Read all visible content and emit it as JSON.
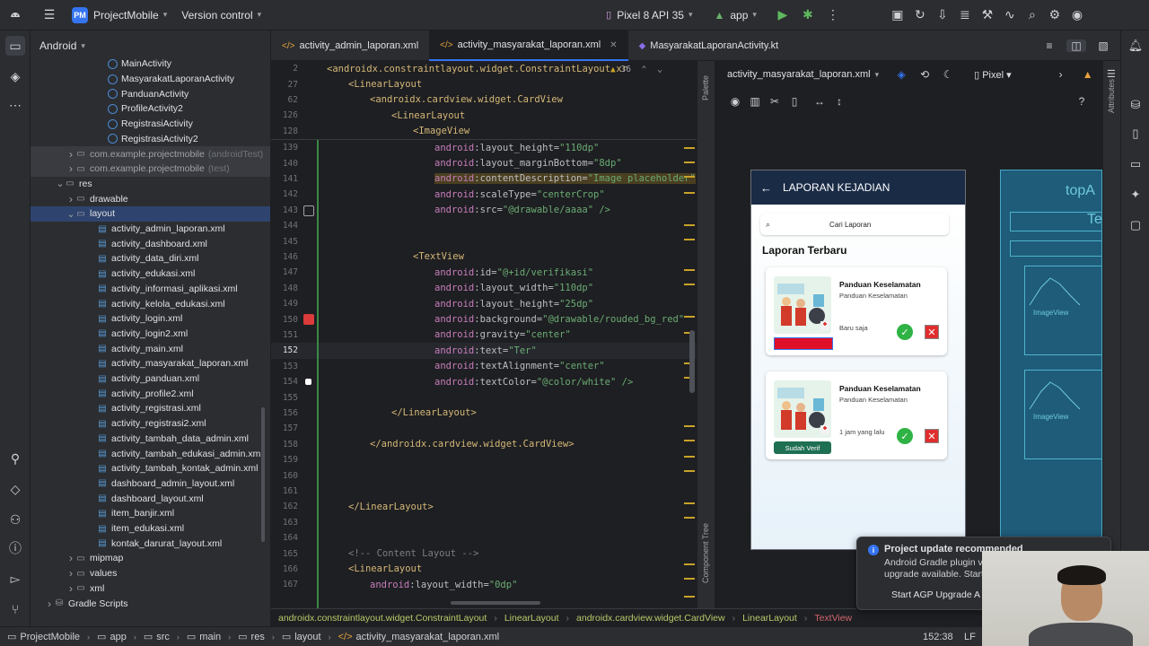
{
  "topbar": {
    "project_badge": "PM",
    "project_name": "ProjectMobile",
    "vcs": "Version control",
    "device": "Pixel 8 API 35",
    "run_config": "app"
  },
  "project_panel": {
    "view": "Android",
    "items": [
      {
        "label": "MainActivity",
        "kind": "class",
        "indent": 6
      },
      {
        "label": "MasyarakatLaporanActivity",
        "kind": "class",
        "indent": 6
      },
      {
        "label": "PanduanActivity",
        "kind": "class",
        "indent": 6
      },
      {
        "label": "ProfileActivity2",
        "kind": "class",
        "indent": 6
      },
      {
        "label": "RegistrasiActivity",
        "kind": "class",
        "indent": 6
      },
      {
        "label": "RegistrasiActivity2",
        "kind": "class",
        "indent": 6
      },
      {
        "label": "com.example.projectmobile",
        "suffix": "(androidTest)",
        "kind": "pkg",
        "indent": 3,
        "hl": true
      },
      {
        "label": "com.example.projectmobile",
        "suffix": "(test)",
        "kind": "pkg",
        "indent": 3,
        "hl": true
      },
      {
        "label": "res",
        "kind": "folder-open",
        "indent": 2
      },
      {
        "label": "drawable",
        "kind": "folder",
        "indent": 3
      },
      {
        "label": "layout",
        "kind": "folder-open",
        "indent": 3,
        "sel": true
      },
      {
        "label": "activity_admin_laporan.xml",
        "kind": "xml",
        "indent": 5
      },
      {
        "label": "activity_dashboard.xml",
        "kind": "xml",
        "indent": 5
      },
      {
        "label": "activity_data_diri.xml",
        "kind": "xml",
        "indent": 5
      },
      {
        "label": "activity_edukasi.xml",
        "kind": "xml",
        "indent": 5
      },
      {
        "label": "activity_informasi_aplikasi.xml",
        "kind": "xml",
        "indent": 5
      },
      {
        "label": "activity_kelola_edukasi.xml",
        "kind": "xml",
        "indent": 5
      },
      {
        "label": "activity_login.xml",
        "kind": "xml",
        "indent": 5
      },
      {
        "label": "activity_login2.xml",
        "kind": "xml",
        "indent": 5
      },
      {
        "label": "activity_main.xml",
        "kind": "xml",
        "indent": 5
      },
      {
        "label": "activity_masyarakat_laporan.xml",
        "kind": "xml",
        "indent": 5
      },
      {
        "label": "activity_panduan.xml",
        "kind": "xml",
        "indent": 5
      },
      {
        "label": "activity_profile2.xml",
        "kind": "xml",
        "indent": 5
      },
      {
        "label": "activity_registrasi.xml",
        "kind": "xml",
        "indent": 5
      },
      {
        "label": "activity_registrasi2.xml",
        "kind": "xml",
        "indent": 5
      },
      {
        "label": "activity_tambah_data_admin.xml",
        "kind": "xml",
        "indent": 5
      },
      {
        "label": "activity_tambah_edukasi_admin.xml",
        "kind": "xml",
        "indent": 5
      },
      {
        "label": "activity_tambah_kontak_admin.xml",
        "kind": "xml",
        "indent": 5
      },
      {
        "label": "dashboard_admin_layout.xml",
        "kind": "xml",
        "indent": 5
      },
      {
        "label": "dashboard_layout.xml",
        "kind": "xml",
        "indent": 5
      },
      {
        "label": "item_banjir.xml",
        "kind": "xml",
        "indent": 5
      },
      {
        "label": "item_edukasi.xml",
        "kind": "xml",
        "indent": 5
      },
      {
        "label": "kontak_darurat_layout.xml",
        "kind": "xml",
        "indent": 5
      },
      {
        "label": "mipmap",
        "kind": "folder",
        "indent": 3
      },
      {
        "label": "values",
        "kind": "folder",
        "indent": 3
      },
      {
        "label": "xml",
        "kind": "folder",
        "indent": 3
      },
      {
        "label": "Gradle Scripts",
        "kind": "gradle",
        "indent": 1
      }
    ]
  },
  "tabs": [
    {
      "label": "activity_admin_laporan.xml",
      "kind": "xml",
      "active": false
    },
    {
      "label": "activity_masyarakat_laporan.xml",
      "kind": "xml",
      "active": true
    },
    {
      "label": "MasyarakatLaporanActivity.kt",
      "kind": "kt",
      "active": false
    }
  ],
  "editor": {
    "inspection_count": "36",
    "sticky": [
      {
        "ln": "2",
        "indent": 0,
        "text": "<androidx.constraintlayout.widget.ConstraintLayout xr"
      },
      {
        "ln": "27",
        "indent": 1,
        "text": "<LinearLayout"
      },
      {
        "ln": "62",
        "indent": 2,
        "text": "<androidx.cardview.widget.CardView"
      },
      {
        "ln": "126",
        "indent": 3,
        "text": "<LinearLayout"
      },
      {
        "ln": "128",
        "indent": 4,
        "text": "<ImageView"
      }
    ],
    "lines": [
      {
        "ln": "139",
        "ns": "android",
        "attr": "layout_height",
        "val": "\"110dp\""
      },
      {
        "ln": "140",
        "ns": "android",
        "attr": "layout_marginBottom",
        "val": "\"8dp\""
      },
      {
        "ln": "141",
        "ns": "android",
        "attr": "contentDescription",
        "val": "\"Image placeholder\"",
        "warn": true
      },
      {
        "ln": "142",
        "ns": "android",
        "attr": "scaleType",
        "val": "\"centerCrop\""
      },
      {
        "ln": "143",
        "ns": "android",
        "attr": "src",
        "val": "\"@drawable/aaaa\" />"
      },
      {
        "ln": "144",
        "raw": ""
      },
      {
        "ln": "145",
        "raw": ""
      },
      {
        "ln": "146",
        "tag": "<TextView",
        "indent": 4
      },
      {
        "ln": "147",
        "ns": "android",
        "attr": "id",
        "val": "\"@+id/verifikasi\""
      },
      {
        "ln": "148",
        "ns": "android",
        "attr": "layout_width",
        "val": "\"110dp\""
      },
      {
        "ln": "149",
        "ns": "android",
        "attr": "layout_height",
        "val": "\"25dp\""
      },
      {
        "ln": "150",
        "ns": "android",
        "attr": "background",
        "val": "\"@drawable/rouded_bg_red\""
      },
      {
        "ln": "151",
        "ns": "android",
        "attr": "gravity",
        "val": "\"center\""
      },
      {
        "ln": "152",
        "ns": "android",
        "attr": "text",
        "val": "\"Ter\"",
        "current": true
      },
      {
        "ln": "153",
        "ns": "android",
        "attr": "textAlignment",
        "val": "\"center\""
      },
      {
        "ln": "154",
        "ns": "android",
        "attr": "textColor",
        "val": "\"@color/white\" />"
      },
      {
        "ln": "155",
        "raw": ""
      },
      {
        "ln": "156",
        "tag": "</LinearLayout>",
        "indent": 3
      },
      {
        "ln": "157",
        "raw": ""
      },
      {
        "ln": "158",
        "tag": "</androidx.cardview.widget.CardView>",
        "indent": 2
      },
      {
        "ln": "159",
        "raw": ""
      },
      {
        "ln": "160",
        "raw": ""
      },
      {
        "ln": "161",
        "raw": ""
      },
      {
        "ln": "162",
        "tag": "</LinearLayout>",
        "indent": 1
      },
      {
        "ln": "163",
        "raw": ""
      },
      {
        "ln": "164",
        "raw": ""
      },
      {
        "ln": "165",
        "comment": "<!-- Content Layout -->",
        "indent": 1
      },
      {
        "ln": "166",
        "tag": "<LinearLayout",
        "indent": 1
      },
      {
        "ln": "167",
        "ns": "android",
        "attr": "layout_width",
        "val": "\"0dp\"",
        "indent": 2
      }
    ]
  },
  "design": {
    "file": "activity_masyarakat_laporan.xml",
    "device": "Pixel",
    "palette_label": "Palette",
    "component_tree_label": "Component Tree",
    "attributes_label": "Attributes",
    "blueprint_texts": [
      "topA",
      "Tex"
    ],
    "blueprint_image_label": "ImageView"
  },
  "app": {
    "toolbar_title": "LAPORAN KEJADIAN",
    "search_placeholder": "Cari Laporan",
    "section_title": "Laporan Terbaru",
    "cards": [
      {
        "title": "Panduan Keselamatan",
        "subtitle": "Panduan Keselamatan",
        "time": "Baru saja",
        "status": ""
      },
      {
        "title": "Panduan Keselamatan",
        "subtitle": "Panduan Keselamatan",
        "time": "1 jam yang lalu",
        "status": "Sudah Verif"
      }
    ]
  },
  "breadcrumbs": [
    "androidx.constraintlayout.widget.ConstraintLayout",
    "LinearLayout",
    "androidx.cardview.widget.CardView",
    "LinearLayout",
    "TextView"
  ],
  "statusbar": {
    "path": [
      "ProjectMobile",
      "app",
      "src",
      "main",
      "res",
      "layout",
      "activity_masyarakat_laporan.xml"
    ],
    "position": "152:38",
    "line_sep": "LF"
  },
  "notification": {
    "title": "Project update recommended",
    "body": "Android Gradle plugin v upgrade available. Start",
    "action": "Start AGP Upgrade A"
  },
  "colors": {
    "accent": "#3574f0",
    "app_toolbar": "#1a2b46",
    "verif_red": "#e0102a",
    "verif_green": "#1f6f53"
  }
}
